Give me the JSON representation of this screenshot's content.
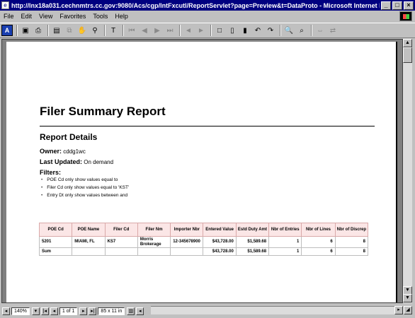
{
  "window": {
    "title": "http://lnx18a031.cechnmtrs.cc.gov:9080/Acs/cgp/IntFxcutl/ReportServlet?page=Preview&t=DataProto - Microsoft Internet Explorer p"
  },
  "menu": [
    "File",
    "Edit",
    "View",
    "Favorites",
    "Tools",
    "Help"
  ],
  "report": {
    "title": "Filer Summary Report",
    "details_heading": "Report Details",
    "owner_label": "Owner:",
    "owner_value": "cddg1wc",
    "updated_label": "Last Updated:",
    "updated_value": "On demand",
    "filters_label": "Filters:",
    "filters": [
      "POE Cd only show values equal to",
      "Filer Cd only show values equal to 'KST'",
      "Entry Dt only show values between  and"
    ],
    "table": {
      "headers": [
        "POE Cd",
        "POE Name",
        "Filer Cd",
        "Filer Nm",
        "Importer Nbr",
        "Entered Value",
        "Estd Duty Amt",
        "Nbr of Entries",
        "Nbr of Lines",
        "Nbr of Discrep"
      ],
      "row": [
        "5201",
        "MIAMI, FL",
        "KS7",
        "Morris Brokerage",
        "12-345678900",
        "$43,728.00",
        "$1,589.68",
        "1",
        "6",
        "8"
      ],
      "sum": [
        "Sum",
        "",
        "",
        "",
        "",
        "$43,728.00",
        "$1,589.68",
        "1",
        "6",
        "8"
      ]
    }
  },
  "status": {
    "zoom": "140%",
    "page": "1 of 1",
    "paper": "85 x 11 in"
  }
}
